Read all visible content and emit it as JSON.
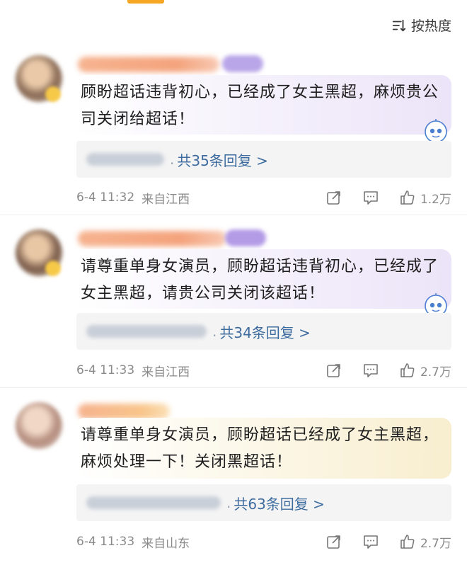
{
  "sort": {
    "label": "按热度",
    "icon": "sort-icon"
  },
  "comments": [
    {
      "text": "顾盼超话违背初心，已经成了女主黑超，麻烦贵公司关闭给超话！",
      "replies": "共35条回复 >",
      "time": "6-4 11:32",
      "location": "来自江西",
      "likes": "1.2万"
    },
    {
      "text": "请尊重单身女演员，顾盼超话违背初心，已经成了女主黑超，请贵公司关闭该超话！",
      "replies": "共34条回复 >",
      "time": "6-4 11:33",
      "location": "来自江西",
      "likes": "2.7万"
    },
    {
      "text": "请尊重单身女演员，顾盼超话已经成了女主黑超，麻烦处理一下！关闭黑超话！",
      "replies": "共63条回复 >",
      "time": "6-4 11:33",
      "location": "来自山东",
      "likes": "2.7万"
    }
  ],
  "colors": {
    "link": "#3e6c9f",
    "meta": "#8a8a8a",
    "bubble_purple": "#ece4f8",
    "bubble_yellow": "#f8eecf"
  }
}
